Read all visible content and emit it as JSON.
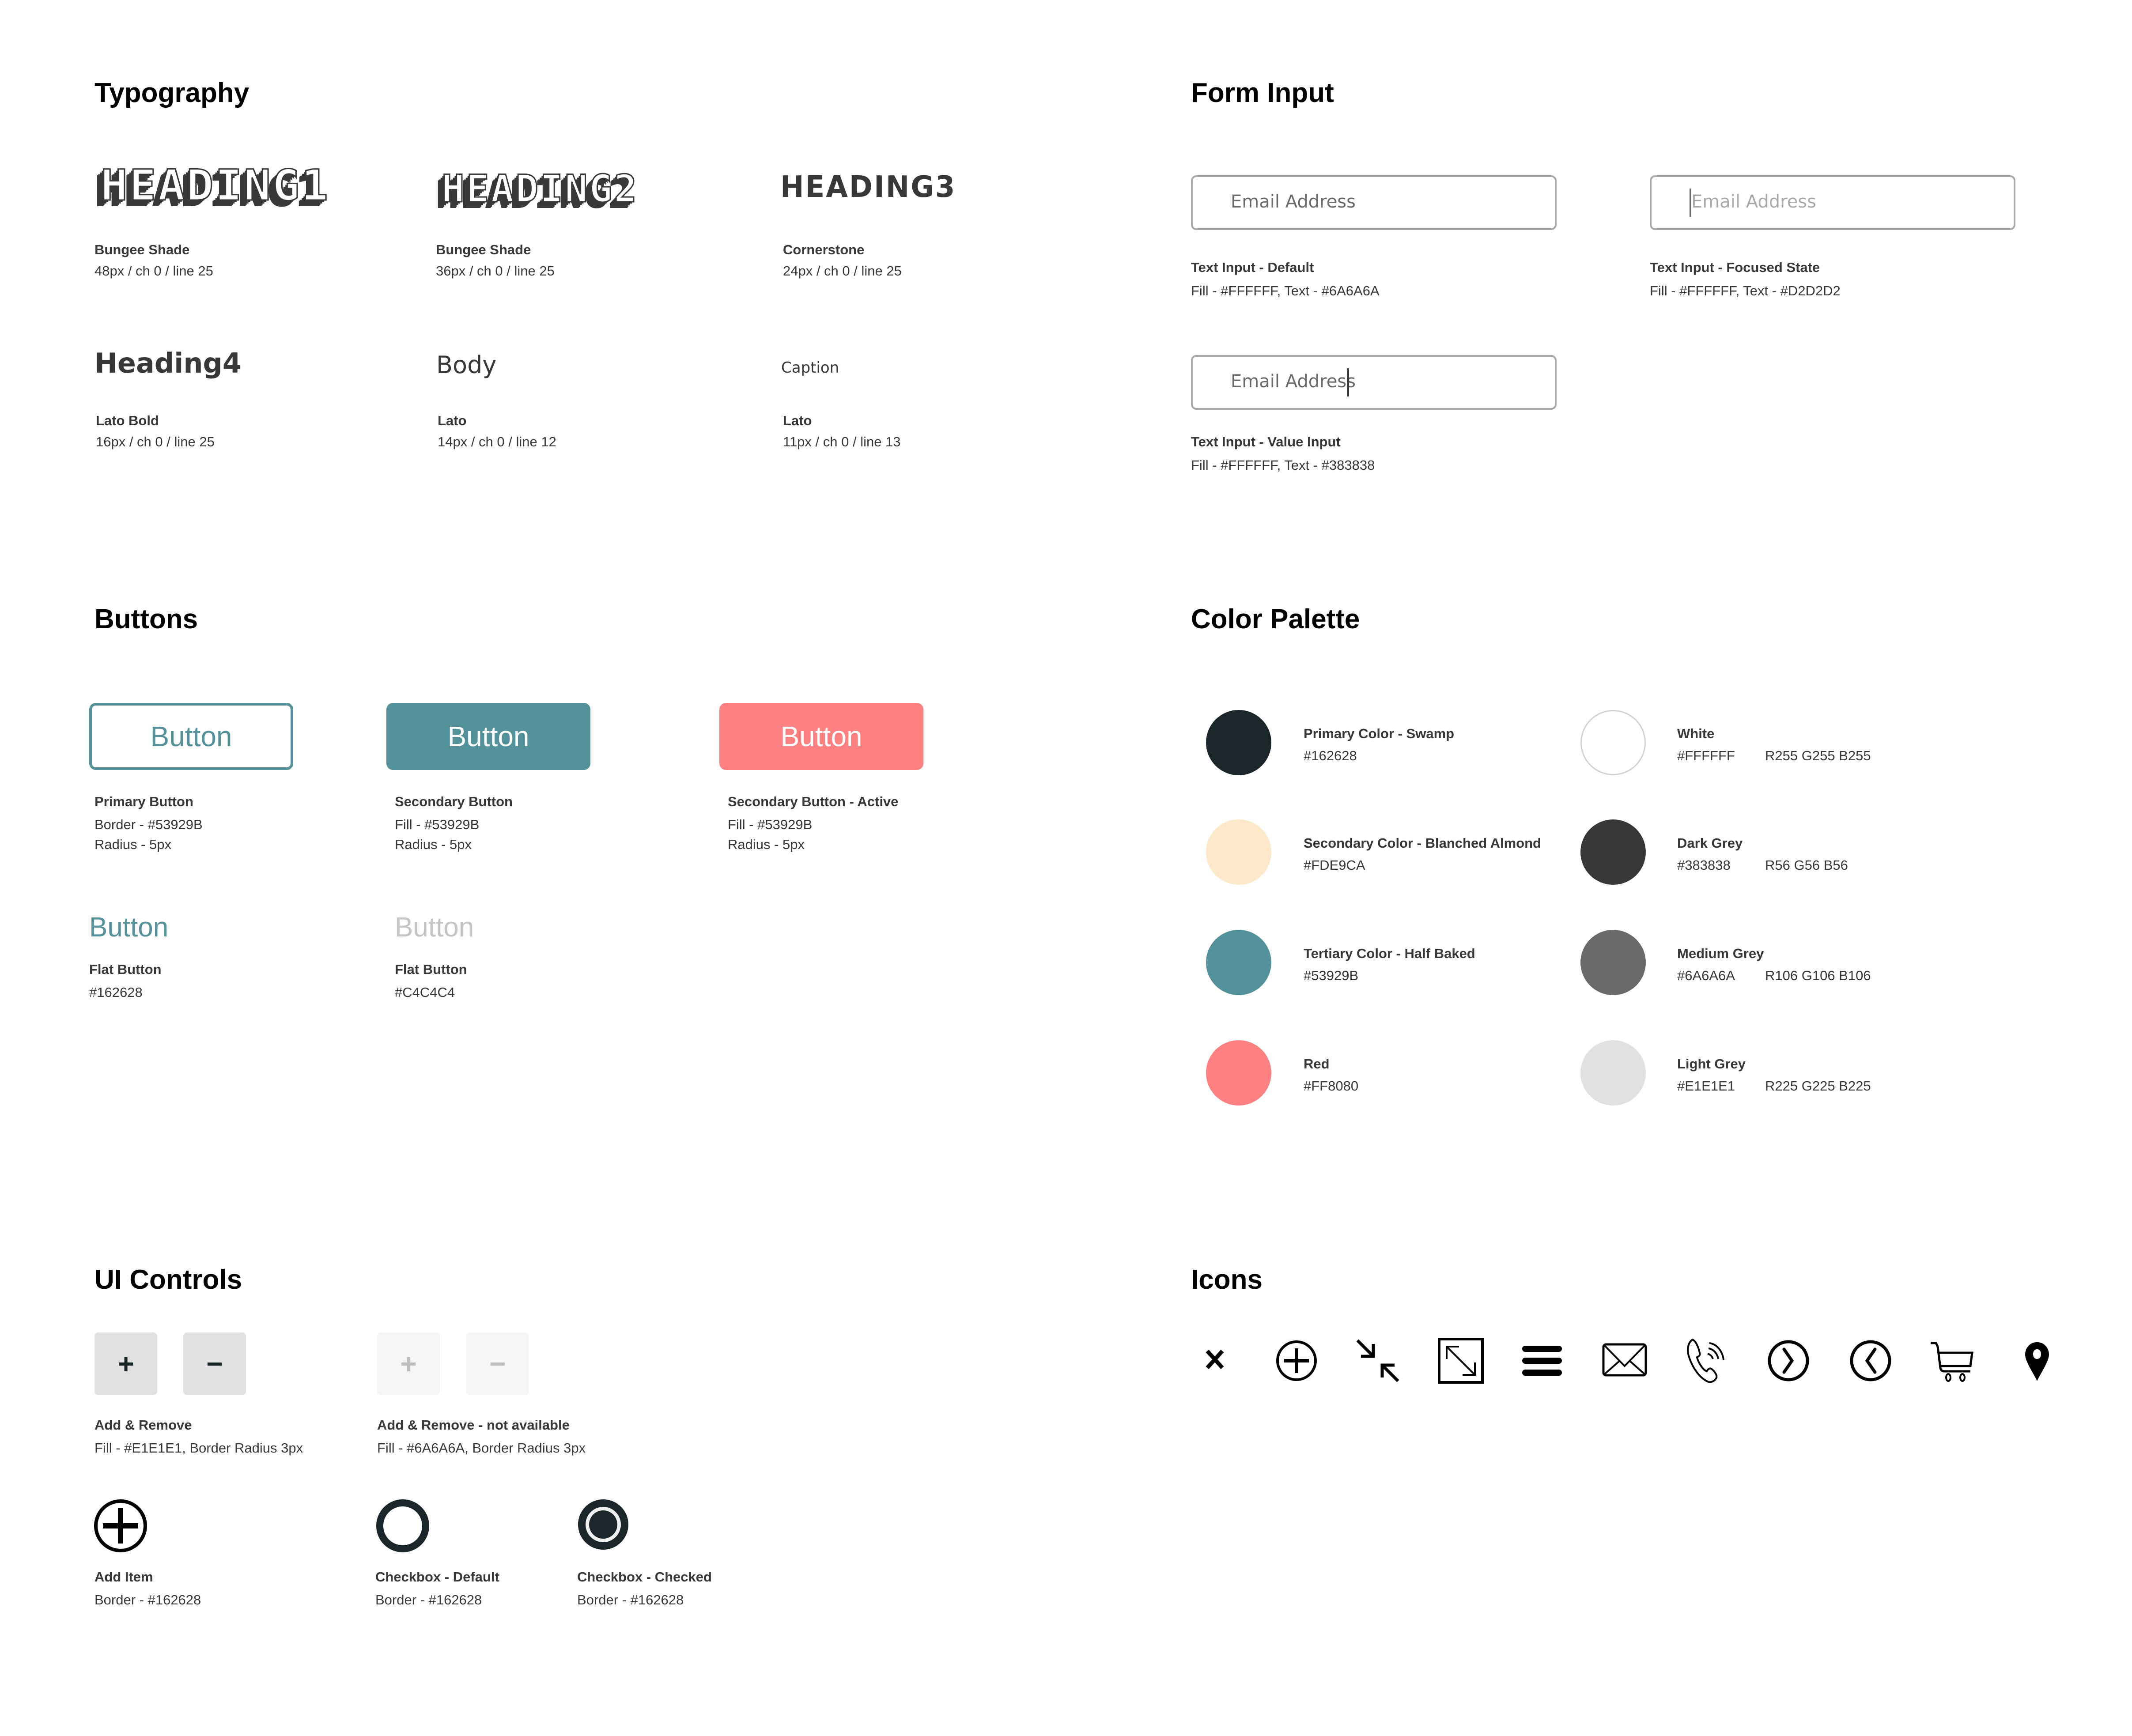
{
  "typography": {
    "title": "Typography",
    "samples": [
      {
        "text": "HEADING1",
        "font": "Bungee Shade",
        "spec": "48px / ch 0 / line 25"
      },
      {
        "text": "HEADING2",
        "font": "Bungee Shade",
        "spec": "36px / ch 0 / line 25"
      },
      {
        "text": "HEADING3",
        "font": "Cornerstone",
        "spec": "24px / ch 0 / line 25"
      },
      {
        "text": "Heading4",
        "font": "Lato Bold",
        "spec": "16px / ch 0 / line 25"
      },
      {
        "text": "Body",
        "font": "Lato",
        "spec": "14px / ch 0 / line 12"
      },
      {
        "text": "Caption",
        "font": "Lato",
        "spec": "11px / ch 0 / line 13"
      }
    ]
  },
  "form_input": {
    "title": "Form Input",
    "fields": [
      {
        "placeholder": "Email Address",
        "label": "Text Input - Default",
        "spec": "Fill - #FFFFFF, Text - #6A6A6A",
        "text_color": "#6A6A6A"
      },
      {
        "placeholder": "Email Address",
        "label": "Text Input - Focused State",
        "spec": "Fill - #FFFFFF, Text - #D2D2D2",
        "text_color": "#D2D2D2"
      },
      {
        "value": "Email Address",
        "label": "Text Input - Value Input",
        "spec": "Fill - #FFFFFF, Text - #383838",
        "text_color": "#383838"
      }
    ]
  },
  "buttons": {
    "title": "Buttons",
    "items": [
      {
        "label": "Button",
        "name": "Primary Button",
        "spec1": "Border - #53929B",
        "spec2": "Radius - 5px"
      },
      {
        "label": "Button",
        "name": "Secondary Button",
        "spec1": "Fill - #53929B",
        "spec2": "Radius - 5px"
      },
      {
        "label": "Button",
        "name": "Secondary Button - Active",
        "spec1": "Fill - #53929B",
        "spec2": "Radius - 5px"
      }
    ],
    "flat": [
      {
        "label": "Button",
        "name": "Flat Button",
        "spec": "#162628",
        "color": "#53929B"
      },
      {
        "label": "Button",
        "name": "Flat Button",
        "spec": "#C4C4C4",
        "color": "#C4C4C4"
      }
    ]
  },
  "color_palette": {
    "title": "Color Palette",
    "left": [
      {
        "name": "Primary Color - Swamp",
        "hex": "#162628",
        "swatch": "#1A2629"
      },
      {
        "name": "Secondary Color - Blanched Almond",
        "hex": "#FDE9CA",
        "swatch": "#FDE9CA"
      },
      {
        "name": "Tertiary Color - Half Baked",
        "hex": "#53929B",
        "swatch": "#53929B"
      },
      {
        "name": "Red",
        "hex": "#FF8080",
        "swatch": "#FF8080"
      }
    ],
    "right": [
      {
        "name": "White",
        "hex": "#FFFFFF",
        "rgb": "R255 G255 B255",
        "swatch": "#FFFFFF"
      },
      {
        "name": "Dark Grey",
        "hex": "#383838",
        "rgb": "R56 G56 B56",
        "swatch": "#383838"
      },
      {
        "name": "Medium Grey",
        "hex": "#6A6A6A",
        "rgb": "R106 G106 B106",
        "swatch": "#6A6A6A"
      },
      {
        "name": "Light Grey",
        "hex": "#E1E1E1",
        "rgb": "R225 G225 B225",
        "swatch": "#E1E1E1"
      }
    ]
  },
  "ui_controls": {
    "title": "UI Controls",
    "add_remove": {
      "plus": "+",
      "minus": "−",
      "name": "Add & Remove",
      "spec": "Fill - #E1E1E1, Border Radius 3px"
    },
    "add_remove_disabled": {
      "plus": "+",
      "minus": "−",
      "name": "Add & Remove - not available",
      "spec": "Fill - #6A6A6A, Border Radius 3px"
    },
    "add_item": {
      "name": "Add Item",
      "spec": "Border - #162628"
    },
    "checkbox_default": {
      "name": "Checkbox - Default",
      "spec": "Border - #162628"
    },
    "checkbox_checked": {
      "name": "Checkbox - Checked",
      "spec": "Border - #162628"
    }
  },
  "icons": {
    "title": "Icons",
    "items": [
      "close-icon",
      "plus-circle-icon",
      "collapse-icon",
      "expand-icon",
      "menu-icon",
      "mail-icon",
      "phone-icon",
      "chevron-right-circle-icon",
      "chevron-left-circle-icon",
      "cart-icon",
      "location-pin-icon"
    ]
  }
}
